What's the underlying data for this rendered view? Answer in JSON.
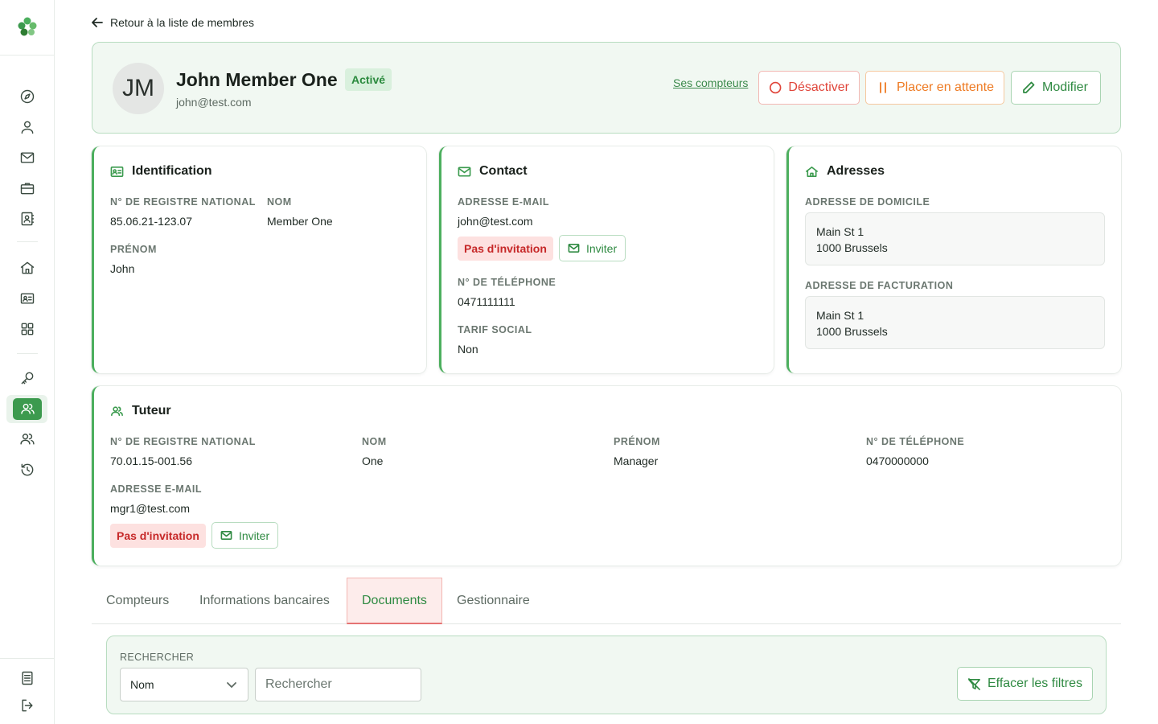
{
  "back_link": "Retour à la liste de membres",
  "member": {
    "initials": "JM",
    "name": "John Member One",
    "status": "Activé",
    "email": "john@test.com"
  },
  "header_actions": {
    "counters_link": "Ses compteurs",
    "deactivate": "Désactiver",
    "hold": "Placer en attente",
    "edit": "Modifier"
  },
  "identification": {
    "title": "Identification",
    "nrn_label": "N° de registre national",
    "nrn": "85.06.21-123.07",
    "lastname_label": "Nom",
    "lastname": "Member One",
    "firstname_label": "Prénom",
    "firstname": "John"
  },
  "contact": {
    "title": "Contact",
    "email_label": "Adresse e-mail",
    "email": "john@test.com",
    "invite_status": "Pas d'invitation",
    "invite_button": "Inviter",
    "phone_label": "N° de téléphone",
    "phone": "0471111111",
    "social_label": "Tarif social",
    "social": "Non"
  },
  "addresses": {
    "title": "Adresses",
    "home_label": "Adresse de domicile",
    "home_line1": "Main St 1",
    "home_line2": "1000 Brussels",
    "billing_label": "Adresse de facturation",
    "billing_line1": "Main St 1",
    "billing_line2": "1000 Brussels"
  },
  "guardian": {
    "title": "Tuteur",
    "nrn_label": "N° de registre national",
    "nrn": "70.01.15-001.56",
    "lastname_label": "Nom",
    "lastname": "One",
    "firstname_label": "Prénom",
    "firstname": "Manager",
    "phone_label": "N° de téléphone",
    "phone": "0470000000",
    "email_label": "Adresse e-mail",
    "email": "mgr1@test.com",
    "invite_status": "Pas d'invitation",
    "invite_button": "Inviter"
  },
  "tabs": [
    {
      "label": "Compteurs",
      "active": false
    },
    {
      "label": "Informations bancaires",
      "active": false
    },
    {
      "label": "Documents",
      "active": true
    },
    {
      "label": "Gestionnaire",
      "active": false
    }
  ],
  "filters": {
    "label": "RECHERCHER",
    "select_value": "Nom",
    "search_placeholder": "Rechercher",
    "clear_button": "Effacer les filtres"
  },
  "colors": {
    "primary": "#3c9a4e",
    "danger": "#e0453a",
    "warning": "#ee7a22",
    "card_bg": "#f1f8f2"
  },
  "sidebar_icons": [
    "compass-icon",
    "user-icon",
    "mail-icon",
    "briefcase-icon",
    "contact-book-icon",
    "home-icon",
    "id-card-icon",
    "grid-icon",
    "key-icon",
    "members-icon",
    "managers-icon",
    "history-icon",
    "document-icon",
    "logout-icon"
  ]
}
